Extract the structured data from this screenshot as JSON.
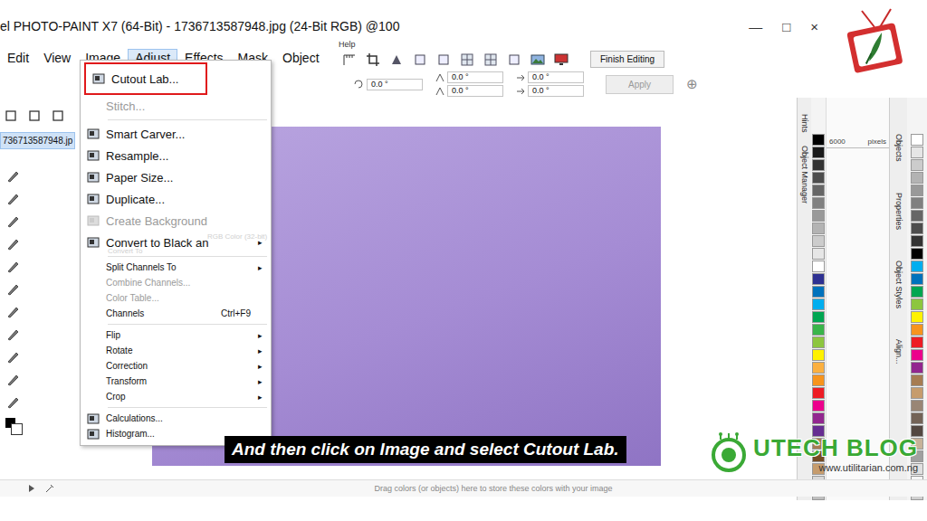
{
  "window": {
    "title": "el PHOTO-PAINT X7 (64-Bit) - 1736713587948.jpg (24-Bit RGB) @100",
    "controls": [
      "—",
      "□",
      "×"
    ]
  },
  "menubar": [
    {
      "label": "Edit",
      "selected": false
    },
    {
      "label": "View",
      "selected": false
    },
    {
      "label": "Image",
      "selected": false
    },
    {
      "label": "Adjust",
      "selected": true
    },
    {
      "label": "Effects",
      "selected": false
    },
    {
      "label": "Mask",
      "selected": false
    },
    {
      "label": "Object",
      "selected": false
    }
  ],
  "help_menu": "Help",
  "toolbar": {
    "finish_button": "Finish Editing"
  },
  "property_bar": {
    "fields": [
      "0.0 °",
      "0.0 °",
      "0.0 °",
      "0.0 °",
      "0.0 °"
    ],
    "apply": {
      "label": "Apply",
      "disabled": true
    },
    "add": "⊕"
  },
  "document_tab": "736713587948.jp",
  "image_menu": {
    "items": [
      {
        "label": "Cutout Lab...",
        "group": 1,
        "icon": true,
        "disabled": false,
        "selected": true,
        "shortcut": "",
        "arrow": ""
      },
      {
        "label": "Stitch...",
        "group": 1,
        "icon": false,
        "disabled": true,
        "selected": false,
        "shortcut": "",
        "arrow": ""
      },
      {
        "label": "Smart Carver...",
        "group": 2,
        "icon": true,
        "disabled": false,
        "selected": false,
        "shortcut": "",
        "arrow": ""
      },
      {
        "label": "Resample...",
        "group": 2,
        "icon": true,
        "disabled": false,
        "selected": false,
        "shortcut": "",
        "arrow": ""
      },
      {
        "label": "Paper Size...",
        "group": 2,
        "icon": true,
        "disabled": false,
        "selected": false,
        "shortcut": "",
        "arrow": ""
      },
      {
        "label": "Duplicate...",
        "group": 2,
        "icon": true,
        "disabled": false,
        "selected": false,
        "shortcut": "",
        "arrow": ""
      },
      {
        "label": "Create Background",
        "group": 2,
        "icon": true,
        "disabled": true,
        "selected": false,
        "shortcut": "",
        "arrow": ""
      },
      {
        "label": "Convert to Black an",
        "group": 2,
        "icon": true,
        "disabled": false,
        "selected": false,
        "shortcut": "",
        "arrow": "▸"
      },
      {
        "label": "Split Channels To",
        "group": 3,
        "icon": false,
        "disabled": false,
        "selected": false,
        "shortcut": "",
        "arrow": "▸"
      },
      {
        "label": "Combine Channels...",
        "group": 3,
        "icon": false,
        "disabled": true,
        "selected": false,
        "shortcut": "",
        "arrow": ""
      },
      {
        "label": "Color Table...",
        "group": 3,
        "icon": false,
        "disabled": true,
        "selected": false,
        "shortcut": "",
        "arrow": ""
      },
      {
        "label": "Channels",
        "group": 3,
        "icon": false,
        "disabled": false,
        "selected": false,
        "shortcut": "Ctrl+F9",
        "arrow": ""
      },
      {
        "label": "Flip",
        "group": 4,
        "icon": false,
        "disabled": false,
        "selected": false,
        "shortcut": "",
        "arrow": "▸"
      },
      {
        "label": "Rotate",
        "group": 4,
        "icon": false,
        "disabled": false,
        "selected": false,
        "shortcut": "",
        "arrow": "▸"
      },
      {
        "label": "Correction",
        "group": 4,
        "icon": false,
        "disabled": false,
        "selected": false,
        "shortcut": "",
        "arrow": "▸"
      },
      {
        "label": "Transform",
        "group": 4,
        "icon": false,
        "disabled": false,
        "selected": false,
        "shortcut": "",
        "arrow": "▸"
      },
      {
        "label": "Crop",
        "group": 4,
        "icon": false,
        "disabled": false,
        "selected": false,
        "shortcut": "",
        "arrow": "▸"
      },
      {
        "label": "Calculations...",
        "group": 5,
        "icon": true,
        "disabled": false,
        "selected": false,
        "shortcut": "",
        "arrow": ""
      },
      {
        "label": "Histogram...",
        "group": 5,
        "icon": true,
        "disabled": false,
        "selected": false,
        "shortcut": "",
        "arrow": ""
      }
    ],
    "ghost_texts": [
      "Convert To",
      "RGB Color (32-bit)"
    ]
  },
  "ruler": {
    "value": "6000",
    "unit": "pixels"
  },
  "dockers": {
    "left_tabs": [
      "Hints",
      "Object Manager"
    ],
    "right_tabs": [
      "Objects",
      "Properties",
      "Object Styles",
      "Align..."
    ]
  },
  "palette_left": [
    {
      "color": "#000000"
    },
    {
      "color": "#1a1a1a"
    },
    {
      "color": "#333333"
    },
    {
      "color": "#4d4d4d"
    },
    {
      "color": "#666666"
    },
    {
      "color": "#808080"
    },
    {
      "color": "#999999"
    },
    {
      "color": "#b3b3b3"
    },
    {
      "color": "#cccccc"
    },
    {
      "color": "#e6e6e6"
    },
    {
      "color": "#ffffff"
    },
    {
      "color": "#2e3192"
    },
    {
      "color": "#0072bc"
    },
    {
      "color": "#00aeef"
    },
    {
      "color": "#00a651"
    },
    {
      "color": "#39b54a"
    },
    {
      "color": "#8dc63f"
    },
    {
      "color": "#fff200"
    },
    {
      "color": "#fbb040"
    },
    {
      "color": "#f7941d"
    },
    {
      "color": "#ed1c24"
    },
    {
      "color": "#ec008c"
    },
    {
      "color": "#92278f"
    },
    {
      "color": "#662d91"
    },
    {
      "color": "#a67c52"
    },
    {
      "color": "#754c24"
    },
    {
      "color": "#c69c6d"
    },
    {
      "color": "#d9d9d9"
    },
    {
      "color": "#bfbfbf"
    }
  ],
  "palette_right": [
    {
      "color": "#ffffff"
    },
    {
      "color": "#e6e6e6"
    },
    {
      "color": "#cccccc"
    },
    {
      "color": "#b3b3b3"
    },
    {
      "color": "#999999"
    },
    {
      "color": "#808080"
    },
    {
      "color": "#666666"
    },
    {
      "color": "#4d4d4d"
    },
    {
      "color": "#333333"
    },
    {
      "color": "#000000"
    },
    {
      "color": "#00aeef"
    },
    {
      "color": "#0072bc"
    },
    {
      "color": "#00a651"
    },
    {
      "color": "#8dc63f"
    },
    {
      "color": "#fff200"
    },
    {
      "color": "#f7941d"
    },
    {
      "color": "#ed1c24"
    },
    {
      "color": "#ec008c"
    },
    {
      "color": "#92278f"
    },
    {
      "color": "#a67c52"
    },
    {
      "color": "#c69c6d"
    },
    {
      "color": "#998675"
    },
    {
      "color": "#736357"
    },
    {
      "color": "#534741"
    },
    {
      "color": "#c7b299"
    },
    {
      "color": "#a0a0a0"
    },
    {
      "color": "#e0e0e0"
    },
    {
      "color": "#f5f5f5"
    },
    {
      "color": "#d0d0d0"
    }
  ],
  "status_bar": "Drag colors (or objects) here to store these colors with your image",
  "caption": "And then click on Image and select Cutout Lab.",
  "watermark": {
    "name": "UTECH BLOG",
    "url": "www.utilitarian.com.ng"
  }
}
